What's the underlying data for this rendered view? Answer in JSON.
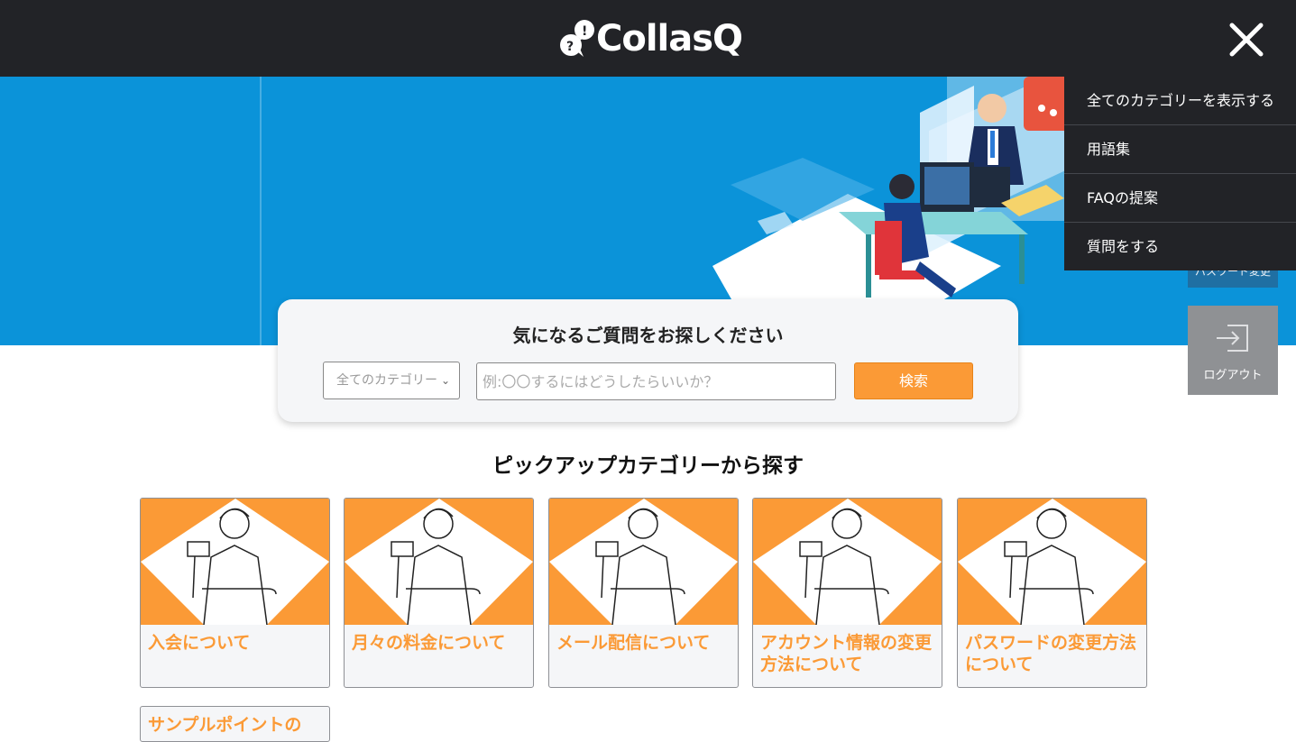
{
  "header": {
    "brand": "CollasQ",
    "close_icon": "close-icon"
  },
  "menu": {
    "items": [
      {
        "label": "全てのカテゴリーを表示する"
      },
      {
        "label": "用語集"
      },
      {
        "label": "FAQの提案"
      },
      {
        "label": "質問をする"
      }
    ]
  },
  "side": {
    "password_change_label": "パスワード変更",
    "logout_label": "ログアウト"
  },
  "search": {
    "title": "気になるご質問をお探しください",
    "category_selected": "全てのカテゴリー",
    "placeholder": "例:〇〇するにはどうしたらいいか？",
    "button_label": "検索"
  },
  "pickup": {
    "title": "ピックアップカテゴリーから探す",
    "cards": [
      {
        "label": "入会について"
      },
      {
        "label": "月々の料金について"
      },
      {
        "label": "メール配信について"
      },
      {
        "label": "アカウント情報の変更方法について"
      },
      {
        "label": "パスワードの変更方法について"
      },
      {
        "label": "サンプルポイントの"
      }
    ]
  },
  "colors": {
    "header_bg": "#222327",
    "hero_bg": "#0b93d9",
    "accent": "#fb9a36",
    "card_bg": "#f5f6f8"
  }
}
